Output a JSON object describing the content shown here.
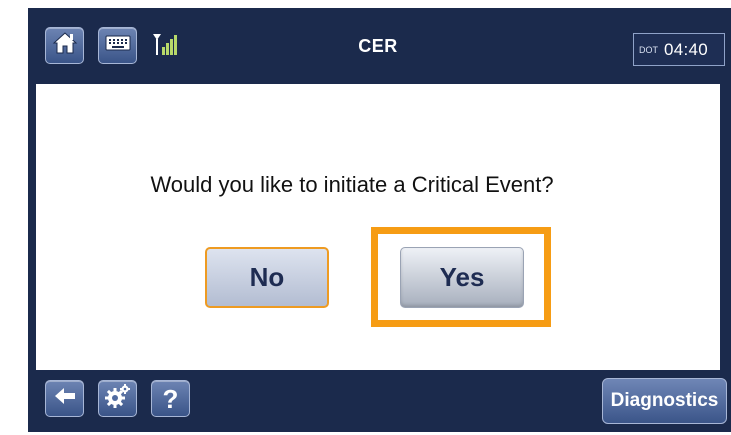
{
  "header": {
    "title": "CER",
    "clock_mode": "DOT",
    "clock_time": "04:40",
    "home_icon": "home-icon",
    "keyboard_icon": "keyboard-icon",
    "signal_icon": "signal-strength-icon"
  },
  "dialog": {
    "question": "Would you like to initiate a Critical Event?",
    "no_label": "No",
    "yes_label": "Yes",
    "highlight_color": "#f69c14"
  },
  "footer": {
    "back_icon": "back-arrow-icon",
    "settings_icon": "gears-icon",
    "help_label": "?",
    "diagnostics_label": "Diagnostics"
  },
  "colors": {
    "frame": "#1b2a4c",
    "button": "#4f6aa0",
    "accent": "#ee9b22"
  }
}
